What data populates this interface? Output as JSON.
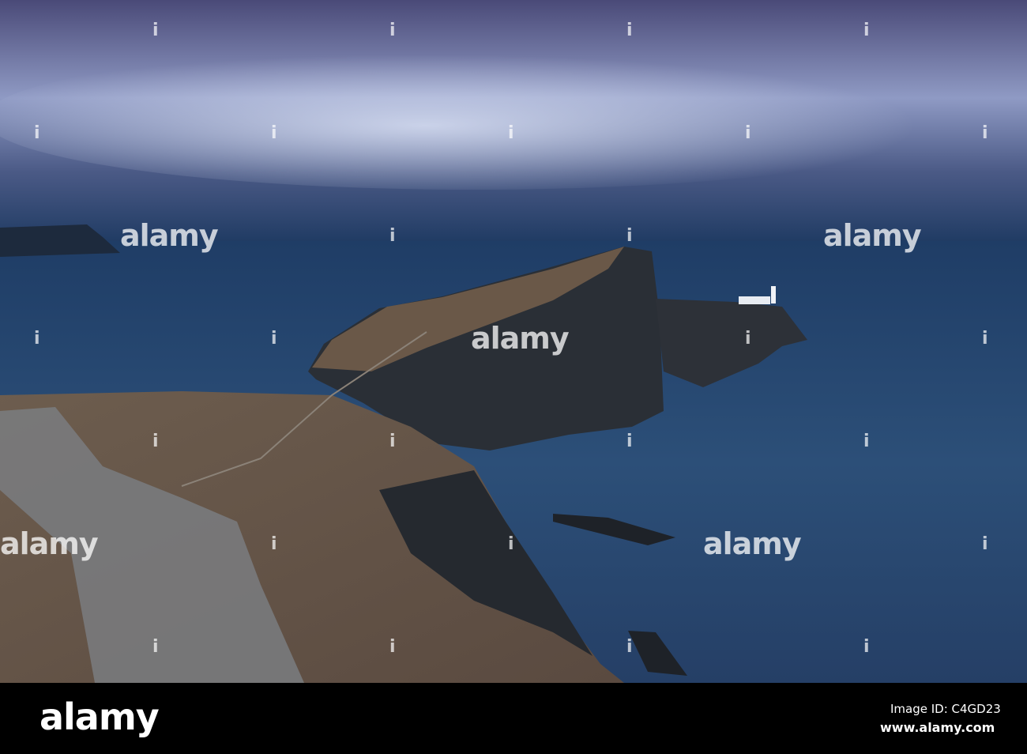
{
  "watermark": {
    "brand": "alamy",
    "marker": "i"
  },
  "footer": {
    "logo": "alamy",
    "image_id": "Image ID: C4GD23",
    "website": "www.alamy.com"
  }
}
